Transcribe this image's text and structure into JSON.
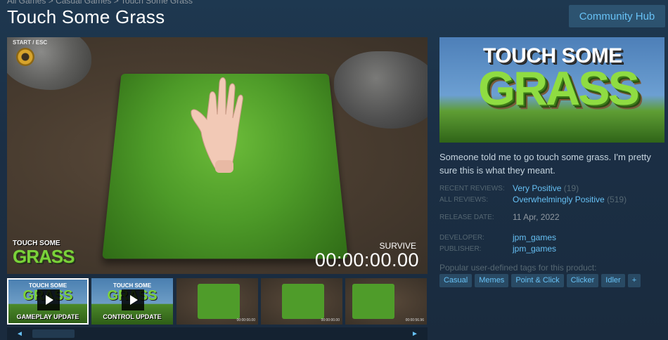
{
  "breadcrumb": {
    "items": [
      "All Games",
      "Casual Games",
      "Touch Some Grass"
    ],
    "separator": ">"
  },
  "title": "Touch Some Grass",
  "community_hub_label": "Community Hub",
  "main_media": {
    "overlay_start": "START / ESC",
    "logo_top": "TOUCH SOME",
    "logo_big": "GRASS",
    "survive_label": "SURVIVE",
    "timer": "00:00:00.00"
  },
  "thumbnails": [
    {
      "top": "TOUCH SOME",
      "big": "GRASS",
      "caption": "GAMEPLAY UPDATE",
      "video": true,
      "selected": true
    },
    {
      "top": "TOUCH SOME",
      "big": "GRASS",
      "caption": "CONTROL UPDATE",
      "video": true,
      "selected": false
    },
    {
      "time": "00:00:00.00",
      "video": false
    },
    {
      "time": "00:00:00.00",
      "video": false
    },
    {
      "time": "00:00:56.96",
      "video": false
    }
  ],
  "scroll": {
    "left": "◄",
    "right": "►"
  },
  "capsule": {
    "line1": "TOUCH SOME",
    "line2": "GRASS"
  },
  "description": "Someone told me to go touch some grass. I'm pretty sure this is what they meant.",
  "reviews": {
    "recent_label": "RECENT REVIEWS:",
    "recent_value": "Very Positive",
    "recent_count": "(19)",
    "all_label": "ALL REVIEWS:",
    "all_value": "Overwhelmingly Positive",
    "all_count": "(519)"
  },
  "release": {
    "label": "RELEASE DATE:",
    "value": "11 Apr, 2022"
  },
  "developer": {
    "label": "DEVELOPER:",
    "value": "jpm_games"
  },
  "publisher": {
    "label": "PUBLISHER:",
    "value": "jpm_games"
  },
  "tags_label": "Popular user-defined tags for this product:",
  "tags": [
    "Casual",
    "Memes",
    "Point & Click",
    "Clicker",
    "Idler"
  ],
  "tag_more": "+",
  "colors": {
    "link": "#66c0f4",
    "background": "#1b2838",
    "accent_green": "#7bd23a"
  }
}
